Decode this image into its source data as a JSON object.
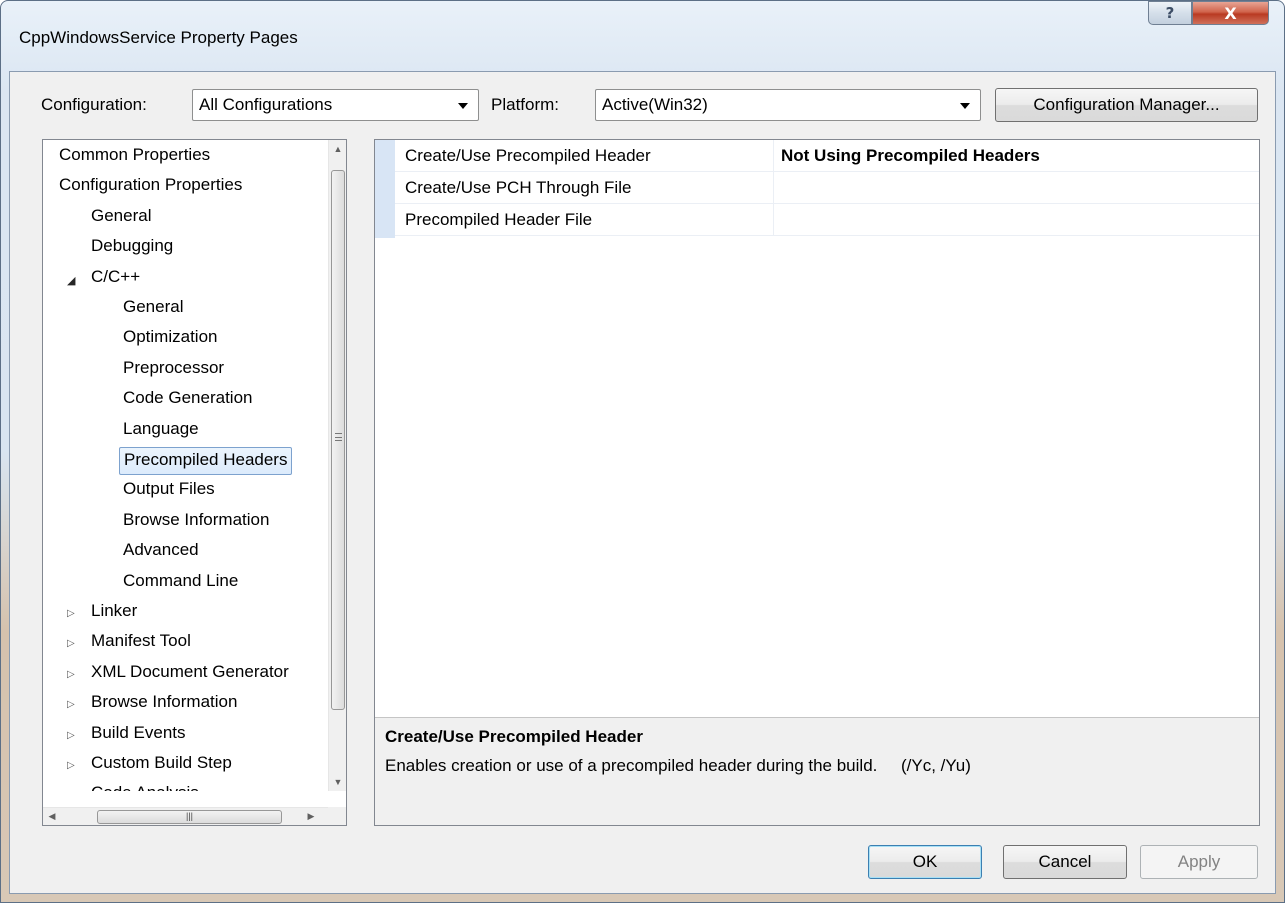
{
  "window": {
    "title": "CppWindowsService Property Pages",
    "help_glyph": "?",
    "close_glyph": "X"
  },
  "config_row": {
    "configuration_label": "Configuration:",
    "configuration_value": "All Configurations",
    "platform_label": "Platform:",
    "platform_value": "Active(Win32)",
    "config_manager_label": "Configuration Manager..."
  },
  "tree": {
    "items": [
      {
        "label": "Common Properties",
        "level": 0
      },
      {
        "label": "Configuration Properties",
        "level": 0
      },
      {
        "label": "General",
        "level": 1
      },
      {
        "label": "Debugging",
        "level": 1
      },
      {
        "label": "C/C++",
        "level": 1,
        "expander": "open"
      },
      {
        "label": "General",
        "level": 2
      },
      {
        "label": "Optimization",
        "level": 2
      },
      {
        "label": "Preprocessor",
        "level": 2
      },
      {
        "label": "Code Generation",
        "level": 2
      },
      {
        "label": "Language",
        "level": 2
      },
      {
        "label": "Precompiled Headers",
        "level": 2,
        "selected": true
      },
      {
        "label": "Output Files",
        "level": 2
      },
      {
        "label": "Browse Information",
        "level": 2
      },
      {
        "label": "Advanced",
        "level": 2
      },
      {
        "label": "Command Line",
        "level": 2
      },
      {
        "label": "Linker",
        "level": 1,
        "expander": "closed"
      },
      {
        "label": "Manifest Tool",
        "level": 1,
        "expander": "closed"
      },
      {
        "label": "XML Document Generator",
        "level": 1,
        "expander": "closed"
      },
      {
        "label": "Browse Information",
        "level": 1,
        "expander": "closed"
      },
      {
        "label": "Build Events",
        "level": 1,
        "expander": "closed"
      },
      {
        "label": "Custom Build Step",
        "level": 1,
        "expander": "closed"
      },
      {
        "label": "Code Analysis",
        "level": 1,
        "expander": "closed"
      }
    ]
  },
  "properties": {
    "rows": [
      {
        "name": "Create/Use Precompiled Header",
        "value": "Not Using Precompiled Headers"
      },
      {
        "name": "Create/Use PCH Through File",
        "value": ""
      },
      {
        "name": "Precompiled Header File",
        "value": ""
      }
    ]
  },
  "description": {
    "title": "Create/Use Precompiled Header",
    "text": "Enables creation or use of a precompiled header during the build.     (/Yc, /Yu)"
  },
  "buttons": {
    "ok": "OK",
    "cancel": "Cancel",
    "apply": "Apply"
  },
  "colors": {
    "selection_border": "#7da2ce",
    "default_button_border": "#3c7fb1",
    "grid_margin": "#d8e5f5"
  }
}
